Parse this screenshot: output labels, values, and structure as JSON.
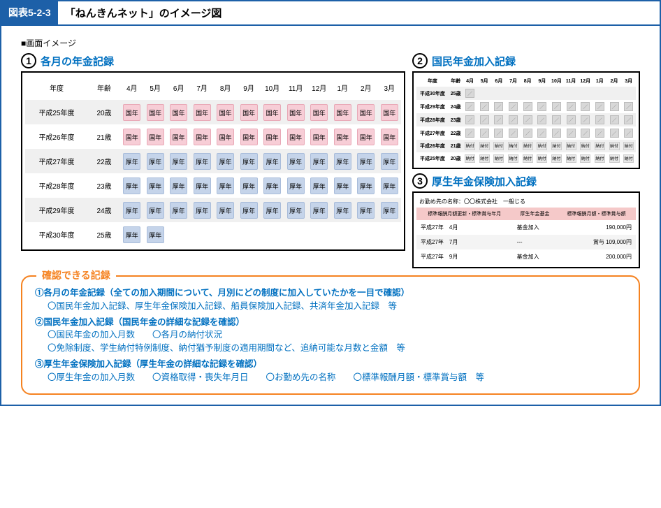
{
  "header": {
    "tag": "図表5-2-3",
    "title": "「ねんきんネット」のイメージ図"
  },
  "caption": "■画面イメージ",
  "section1": {
    "num": "1",
    "title": "各月の年金記録",
    "cols": [
      "年度",
      "年齢",
      "4月",
      "5月",
      "6月",
      "7月",
      "8月",
      "9月",
      "10月",
      "11月",
      "12月",
      "1月",
      "2月",
      "3月"
    ],
    "rows": [
      {
        "y": "平成25年度",
        "a": "20歳",
        "t": "pink",
        "c": "国年",
        "n": 12
      },
      {
        "y": "平成26年度",
        "a": "21歳",
        "t": "pink",
        "c": "国年",
        "n": 12
      },
      {
        "y": "平成27年度",
        "a": "22歳",
        "t": "blue",
        "c": "厚年",
        "n": 12
      },
      {
        "y": "平成28年度",
        "a": "23歳",
        "t": "blue",
        "c": "厚年",
        "n": 12
      },
      {
        "y": "平成29年度",
        "a": "24歳",
        "t": "blue",
        "c": "厚年",
        "n": 12
      },
      {
        "y": "平成30年度",
        "a": "25歳",
        "t": "blue",
        "c": "厚年",
        "n": 2
      }
    ]
  },
  "section2": {
    "num": "2",
    "title": "国民年金加入記録",
    "cols": [
      "年度",
      "年齢",
      "4月",
      "5月",
      "6月",
      "7月",
      "8月",
      "9月",
      "10月",
      "11月",
      "12月",
      "1月",
      "2月",
      "3月"
    ],
    "rows": [
      {
        "y": "平成30年度",
        "a": "25歳",
        "mark": "tick",
        "n": 1
      },
      {
        "y": "平成29年度",
        "a": "24歳",
        "mark": "tick",
        "n": 12
      },
      {
        "y": "平成28年度",
        "a": "23歳",
        "mark": "tick",
        "n": 12
      },
      {
        "y": "平成27年度",
        "a": "22歳",
        "mark": "tick",
        "n": 12
      },
      {
        "y": "平成26年度",
        "a": "21歳",
        "mark": "pay",
        "txt": "納付",
        "n": 12
      },
      {
        "y": "平成25年度",
        "a": "20歳",
        "mark": "pay",
        "txt": "納付",
        "n": 12
      }
    ]
  },
  "section3": {
    "num": "3",
    "title": "厚生年金保険加入記録",
    "employer": "お勤め先の名称：〇〇株式会社　一般じる",
    "headers": [
      "標準報酬月額更新・標準賞与年月",
      "厚生年金基金",
      "標準報酬月額・標準賞与額"
    ],
    "rows": [
      {
        "d": "平成27年　4月",
        "f": "基金加入",
        "v": "190,000円"
      },
      {
        "d": "平成27年　7月",
        "f": "---",
        "v": "賞与 109,000円"
      },
      {
        "d": "平成27年　9月",
        "f": "基金加入",
        "v": "200,000円"
      }
    ]
  },
  "records": {
    "label": "確認できる記録",
    "items": [
      {
        "h": "各月の年金記録（全ての加入期間について、月別にどの制度に加入していたかを一目で確認）",
        "subs": [
          "〇国民年金加入記録、厚生年金保険加入記録、船員保険加入記録、共済年金加入記録　等"
        ]
      },
      {
        "h": "国民年金加入記録（国民年金の詳細な記録を確認）",
        "subs": [
          "〇国民年金の加入月数　　〇各月の納付状況",
          "〇免除制度、学生納付特例制度、納付猶予制度の適用期間など、追納可能な月数と金額　等"
        ]
      },
      {
        "h": "厚生年金保険加入記録（厚生年金の詳細な記録を確認）",
        "subs": [
          "〇厚生年金の加入月数　　〇資格取得・喪失年月日　　〇お勤め先の名称　　〇標準報酬月額・標準賞与額　等"
        ]
      }
    ]
  },
  "chart_data": [
    {
      "type": "table",
      "title": "各月の年金記録",
      "categories": [
        "4月",
        "5月",
        "6月",
        "7月",
        "8月",
        "9月",
        "10月",
        "11月",
        "12月",
        "1月",
        "2月",
        "3月"
      ],
      "series": [
        {
          "name": "平成25年度 20歳",
          "values": [
            "国年",
            "国年",
            "国年",
            "国年",
            "国年",
            "国年",
            "国年",
            "国年",
            "国年",
            "国年",
            "国年",
            "国年"
          ]
        },
        {
          "name": "平成26年度 21歳",
          "values": [
            "国年",
            "国年",
            "国年",
            "国年",
            "国年",
            "国年",
            "国年",
            "国年",
            "国年",
            "国年",
            "国年",
            "国年"
          ]
        },
        {
          "name": "平成27年度 22歳",
          "values": [
            "厚年",
            "厚年",
            "厚年",
            "厚年",
            "厚年",
            "厚年",
            "厚年",
            "厚年",
            "厚年",
            "厚年",
            "厚年",
            "厚年"
          ]
        },
        {
          "name": "平成28年度 23歳",
          "values": [
            "厚年",
            "厚年",
            "厚年",
            "厚年",
            "厚年",
            "厚年",
            "厚年",
            "厚年",
            "厚年",
            "厚年",
            "厚年",
            "厚年"
          ]
        },
        {
          "name": "平成29年度 24歳",
          "values": [
            "厚年",
            "厚年",
            "厚年",
            "厚年",
            "厚年",
            "厚年",
            "厚年",
            "厚年",
            "厚年",
            "厚年",
            "厚年",
            "厚年"
          ]
        },
        {
          "name": "平成30年度 25歳",
          "values": [
            "厚年",
            "厚年",
            "",
            "",
            "",
            "",
            "",
            "",
            "",
            "",
            "",
            ""
          ]
        }
      ]
    },
    {
      "type": "table",
      "title": "厚生年金保険加入記録",
      "categories": [
        "標準報酬月額更新・標準賞与年月",
        "厚生年金基金",
        "標準報酬月額・標準賞与額"
      ],
      "series": [
        {
          "name": "平成27年 4月",
          "values": [
            "基金加入",
            "190,000円"
          ]
        },
        {
          "name": "平成27年 7月",
          "values": [
            "---",
            "賞与 109,000円"
          ]
        },
        {
          "name": "平成27年 9月",
          "values": [
            "基金加入",
            "200,000円"
          ]
        }
      ]
    }
  ]
}
